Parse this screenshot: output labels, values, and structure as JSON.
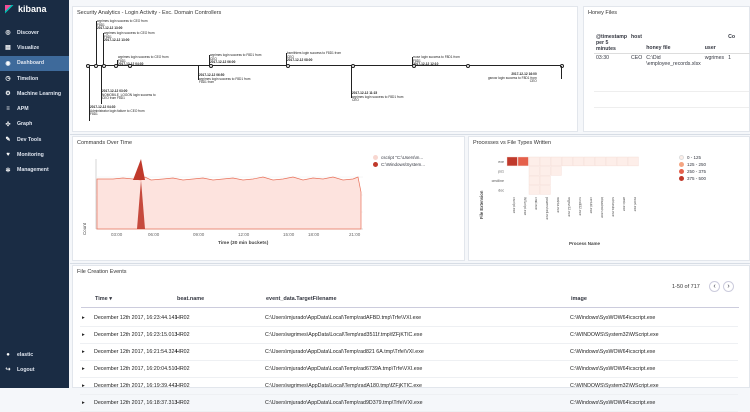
{
  "app": {
    "name": "kibana"
  },
  "nav": {
    "items": [
      {
        "label": "Discover",
        "icon": "compass-icon"
      },
      {
        "label": "Visualize",
        "icon": "chart-icon"
      },
      {
        "label": "Dashboard",
        "icon": "dashboard-icon",
        "active": true
      },
      {
        "label": "Timelion",
        "icon": "timelion-icon"
      },
      {
        "label": "Machine Learning",
        "icon": "ml-icon"
      },
      {
        "label": "APM",
        "icon": "apm-icon"
      },
      {
        "label": "Graph",
        "icon": "graph-icon"
      },
      {
        "label": "Dev Tools",
        "icon": "wrench-icon"
      },
      {
        "label": "Monitoring",
        "icon": "heartbeat-icon"
      },
      {
        "label": "Management",
        "icon": "gear-icon"
      }
    ],
    "bottom": [
      {
        "label": "elastic",
        "icon": "user-icon"
      },
      {
        "label": "Logout",
        "icon": "logout-icon"
      }
    ]
  },
  "timeline_panel": {
    "title": "Security Analytics - Login Activity - Exc. Domain Controllers",
    "events": [
      {
        "date": "2017-12-12 13:00",
        "text": "wgrimes login success to CEO from\nF8D1"
      },
      {
        "date": "2017-12-12 13:00",
        "text": "wgrimes login success to CEO from\nF8D1"
      },
      {
        "date": "2017-12-12 04:30",
        "text": "wgrimes login success to CEO from\nF8D1"
      },
      {
        "date": "2017-12-12 06:00",
        "text": "wgrimes login success to F8D1 from\nCEO"
      },
      {
        "date": "2017-12-12 06:50",
        "text": "wgrimes login success to F8D1 from\nF8D1 from"
      },
      {
        "date": "2017-12-12 08:00",
        "text": "bsmithiers login success to F8D1 from\nCEO"
      },
      {
        "date": "2017-12-12 11:15",
        "text": "wgrimes login success to F8D1 from\nCEO"
      },
      {
        "date": "2017-12-12 12:10",
        "text": "rrose login success to F8D1 from\nF8D1"
      },
      {
        "date": "2017-12-12 16:00",
        "text": "gsnow login success to F8D1 from\nCEO"
      },
      {
        "date": "2017-12-12 03:00",
        "text": "NOMOBILE_LOGON login success to\nCEO from F8D1"
      },
      {
        "date": "2017-12-12 04:30",
        "text": "Administrator login failure to CEO from\nF8D1"
      }
    ]
  },
  "honey_panel": {
    "title": "Honey Files",
    "headers": [
      "@timestamp per 5 minutes",
      "host",
      "honey file",
      "user",
      "Co"
    ],
    "rows": [
      [
        "03:30",
        "CEO",
        "C:\\Did \\employee_records.xlsx",
        "wgrimes",
        "1"
      ]
    ]
  },
  "commands_panel": {
    "title": "Commands Over Time",
    "xlabel": "Time (30 min buckets)",
    "ylabel": "Count",
    "xticks": [
      "03:00",
      "06:00",
      "09:00",
      "12:00",
      "15:00",
      "18:00",
      "21:00"
    ],
    "legend": [
      {
        "label": "cscript \"C:\\Users\\m...",
        "color": "#f8d7d0"
      },
      {
        "label": "C:\\Windows\\System...",
        "color": "#c0392b"
      }
    ],
    "colors": {
      "fill": "#fde3de",
      "line": "#e8715a",
      "spike": "#c0392b"
    }
  },
  "chart_data": {
    "type": "heatmap",
    "xlabel": "Process Name",
    "ylabel": "File Extension",
    "y_categories": [
      "exe",
      "ps1",
      "cmdline",
      "doc"
    ],
    "x_categories": [
      "cscript.exe",
      "WScript.exe",
      "cmd.exe",
      "powershell.exe",
      "mshta.exe",
      "regsvr32.exe",
      "rundll32.exe",
      "certutil.exe",
      "bitsadmin.exe",
      "schtasks.exe",
      "wmic.exe",
      "excel.exe"
    ],
    "legend": [
      {
        "label": "0 - 125",
        "color": "#fdeee9"
      },
      {
        "label": "125 - 250",
        "color": "#f4a582"
      },
      {
        "label": "250 - 375",
        "color": "#e5604b"
      },
      {
        "label": "375 - 500",
        "color": "#c0392b"
      }
    ],
    "cells": [
      {
        "x": 0,
        "y": 0,
        "bucket": 3
      },
      {
        "x": 1,
        "y": 0,
        "bucket": 2
      },
      {
        "x": 2,
        "y": 0,
        "bucket": 0
      },
      {
        "x": 3,
        "y": 0,
        "bucket": 0
      },
      {
        "x": 4,
        "y": 0,
        "bucket": 0
      },
      {
        "x": 5,
        "y": 0,
        "bucket": 0
      },
      {
        "x": 6,
        "y": 0,
        "bucket": 0
      },
      {
        "x": 7,
        "y": 0,
        "bucket": 0
      },
      {
        "x": 8,
        "y": 0,
        "bucket": 0
      },
      {
        "x": 9,
        "y": 0,
        "bucket": 0
      },
      {
        "x": 10,
        "y": 0,
        "bucket": 0
      },
      {
        "x": 11,
        "y": 0,
        "bucket": 0
      },
      {
        "x": 2,
        "y": 1,
        "bucket": 0
      },
      {
        "x": 3,
        "y": 1,
        "bucket": 0
      },
      {
        "x": 4,
        "y": 1,
        "bucket": 0
      },
      {
        "x": 2,
        "y": 2,
        "bucket": 0
      },
      {
        "x": 3,
        "y": 2,
        "bucket": 0
      },
      {
        "x": 2,
        "y": 3,
        "bucket": 0
      },
      {
        "x": 3,
        "y": 3,
        "bucket": 0
      }
    ]
  },
  "heatmap_panel": {
    "title": "Processes vs File Types Written"
  },
  "file_panel": {
    "title": "File Creation Events",
    "pager": "1-50 of 717",
    "headers": [
      "Time",
      "beat.name",
      "event_data.TargetFilename",
      "image"
    ],
    "rows": [
      [
        "December 12th 2017, 16:23:44.141",
        "HR02",
        "C:\\Users\\mjurado\\AppData\\Local\\Temp\\radAFBD.tmp\\Trfe\\VXI.exe",
        "C:\\Windows\\SysWOW64\\cscript.exe"
      ],
      [
        "December 12th 2017, 16:23:15.013",
        "HR02",
        "C:\\Users\\wgrimes\\AppData\\Local\\Temp\\rad3511f.tmp\\fZFjKTIC.exe",
        "C:\\WINDOWS\\System32\\WScript.exe"
      ],
      [
        "December 12th 2017, 16:21:54.324",
        "HR02",
        "C:\\Users\\mjurado\\AppData\\Local\\Temp\\rad821 6A.tmp\\Trfe\\VXI.exe",
        "C:\\Windows\\SysWOW64\\cscript.exe"
      ],
      [
        "December 12th 2017, 16:20:04.510",
        "HR02",
        "C:\\Users\\mjurado\\AppData\\Local\\Temp\\rad6739A.tmp\\Trfe\\VXI.exe",
        "C:\\Windows\\SysWOW64\\cscript.exe"
      ],
      [
        "December 12th 2017, 16:19:39.442",
        "HR02",
        "C:\\Users\\wgrimes\\AppData\\Local\\Temp\\radA180.tmp\\fZFjKTIC.exe",
        "C:\\WINDOWS\\System32\\WScript.exe"
      ],
      [
        "December 12th 2017, 16:18:37.313",
        "HR02",
        "C:\\Users\\mjurado\\AppData\\Local\\Temp\\rad9D379.tmp\\Trfe\\VXI.exe",
        "C:\\Windows\\SysWOW64\\cscript.exe"
      ]
    ]
  }
}
